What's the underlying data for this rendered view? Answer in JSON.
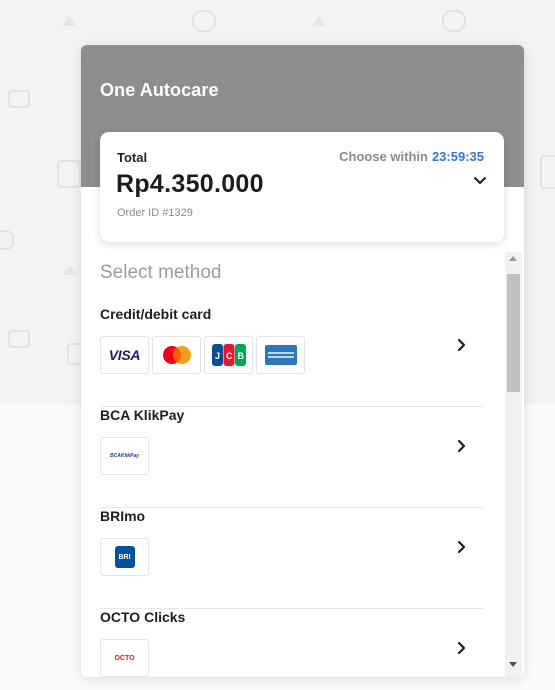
{
  "merchant": {
    "name": "One Autocare"
  },
  "summary": {
    "total_label": "Total",
    "choose_within_label": "Choose within",
    "countdown": "23:59:35",
    "amount": "Rp4.350.000",
    "order_id": "Order ID #1329"
  },
  "methods_section": {
    "title": "Select method",
    "methods": [
      {
        "name": "Credit/debit card",
        "logos": [
          "visa-logo",
          "mastercard-logo",
          "jcb-logo",
          "amex-logo"
        ]
      },
      {
        "name": "BCA KlikPay",
        "logos": [
          "bca-klikpay-logo"
        ]
      },
      {
        "name": "BRImo",
        "logos": [
          "brimo-logo"
        ]
      },
      {
        "name": "OCTO Clicks",
        "logos": [
          "octo-clicks-logo"
        ]
      }
    ]
  },
  "logo_text": {
    "visa": "VISA",
    "bca": "BCAKlikPay",
    "bri": "BRI",
    "octo": "OCTO"
  },
  "colors": {
    "header": "#8e8e8e",
    "countdown": "#3b73d6",
    "visa_blue": "#1a1f71",
    "mastercard_red": "#eb001b",
    "mastercard_orange": "#f79e1b",
    "amex_blue": "#2e77bc",
    "bri_blue": "#00529c"
  }
}
